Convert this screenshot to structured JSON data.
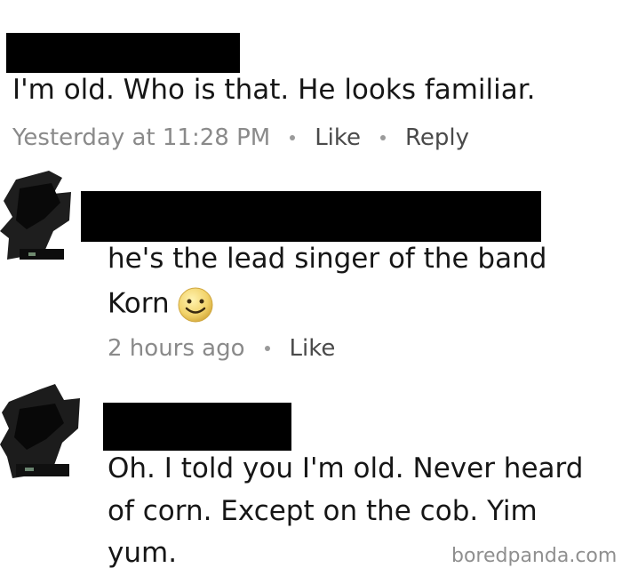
{
  "comments": [
    {
      "text": "I'm old. Who is that. He looks familiar.",
      "meta": {
        "time": "Yesterday at 11:28 PM",
        "like_label": "Like",
        "reply_label": "Reply"
      }
    },
    {
      "text_line1": "he's the lead singer of the band",
      "text_line2": "Korn",
      "emoji": "smiley-face",
      "meta": {
        "time": "2 hours ago",
        "like_label": "Like"
      }
    },
    {
      "text_line1": "Oh. I told you I'm old. Never heard",
      "text_line2": "of corn. Except on the cob. Yim",
      "text_line3": "yum."
    }
  ],
  "watermark": "boredpanda.com"
}
